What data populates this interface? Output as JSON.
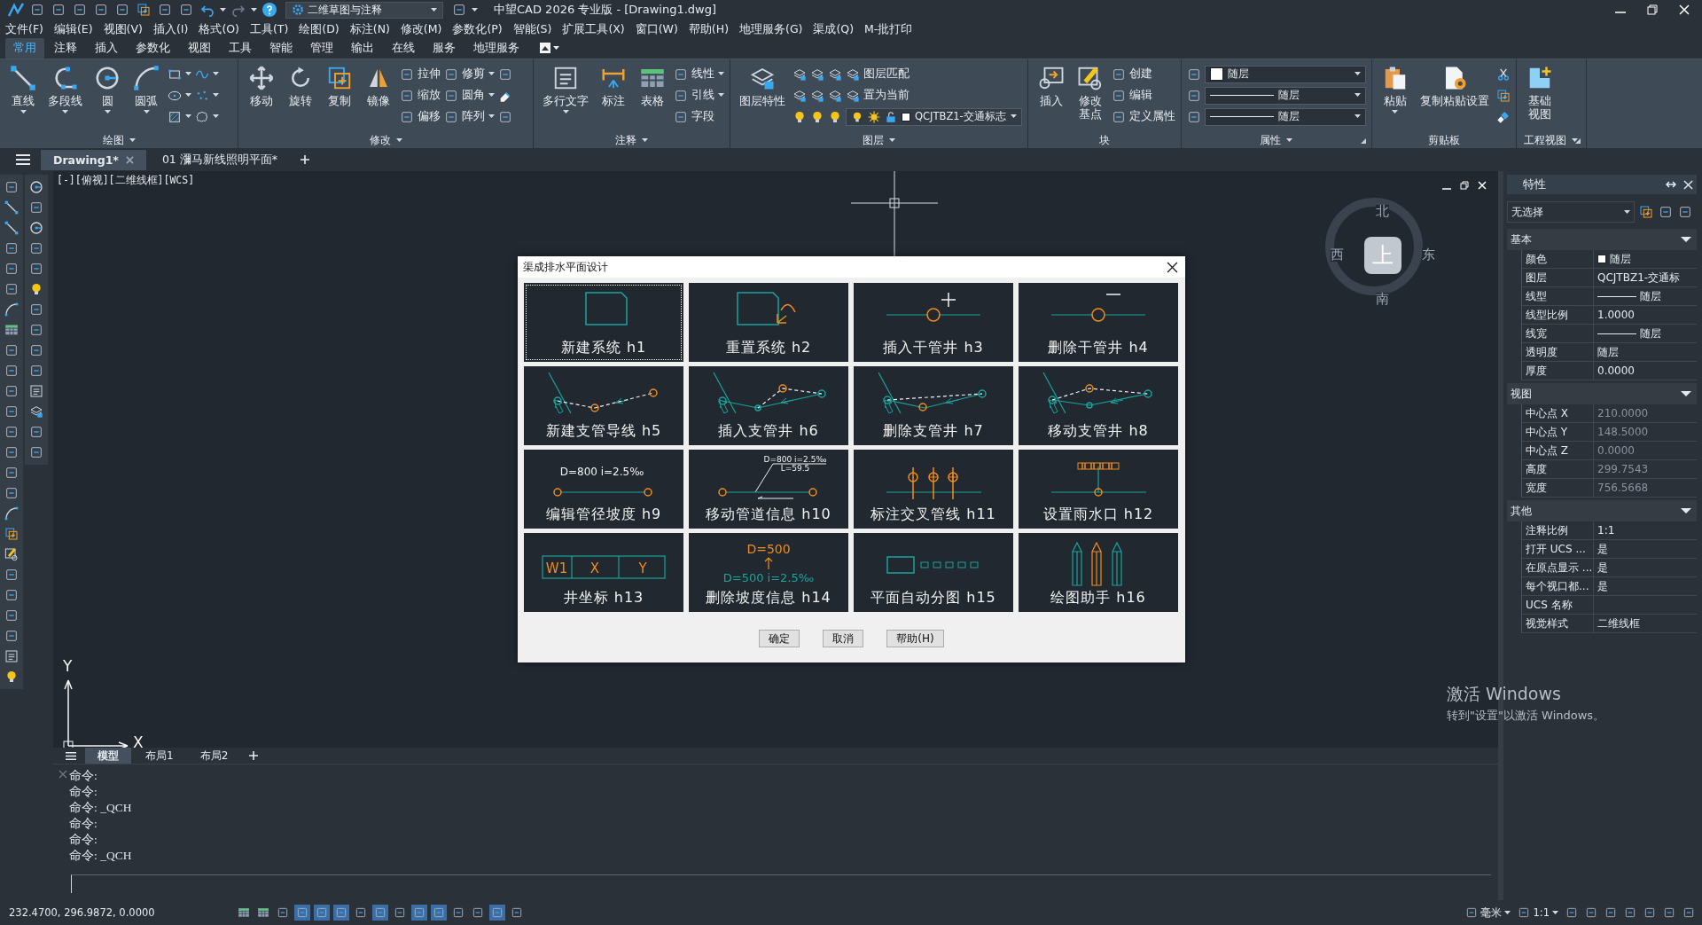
{
  "title_bar": {
    "workspace": "二维草图与注释",
    "title": "中望CAD 2026 专业版 - [Drawing1.dwg]"
  },
  "menu_bar": [
    "文件(F)",
    "编辑(E)",
    "视图(V)",
    "插入(I)",
    "格式(O)",
    "工具(T)",
    "绘图(D)",
    "标注(N)",
    "修改(M)",
    "参数化(P)",
    "智能(S)",
    "扩展工具(X)",
    "窗口(W)",
    "帮助(H)",
    "地理服务(G)",
    "渠成(Q)",
    "M-批打印"
  ],
  "ribbon_tabs": [
    {
      "label": "常用",
      "selected": true
    },
    {
      "label": "注释",
      "selected": false
    },
    {
      "label": "插入",
      "selected": false
    },
    {
      "label": "参数化",
      "selected": false
    },
    {
      "label": "视图",
      "selected": false
    },
    {
      "label": "工具",
      "selected": false
    },
    {
      "label": "智能",
      "selected": false
    },
    {
      "label": "管理",
      "selected": false
    },
    {
      "label": "输出",
      "selected": false
    },
    {
      "label": "在线",
      "selected": false
    },
    {
      "label": "服务",
      "selected": false
    },
    {
      "label": "地理服务",
      "selected": false
    }
  ],
  "ribbon_panels": [
    {
      "title": "绘图",
      "dropdown": true,
      "launcher": false,
      "tools": [
        {
          "kind": "large",
          "label": "直线",
          "dropdown": true
        },
        {
          "kind": "large",
          "label": "多段线",
          "dropdown": true
        },
        {
          "kind": "large",
          "label": "圆",
          "dropdown": true
        },
        {
          "kind": "large",
          "label": "圆弧",
          "dropdown": true
        },
        {
          "kind": "icon",
          "dropdown": true
        },
        {
          "kind": "icon",
          "dropdown": true
        },
        {
          "kind": "icon",
          "dropdown": true
        },
        {
          "kind": "icon",
          "dropdown": true
        },
        {
          "kind": "icon",
          "dropdown": true
        },
        {
          "kind": "icon",
          "dropdown": true
        }
      ]
    },
    {
      "title": "修改",
      "dropdown": true,
      "launcher": false,
      "tools": [
        {
          "kind": "large",
          "label": "移动",
          "dropdown": false
        },
        {
          "kind": "large",
          "label": "旋转",
          "dropdown": false
        },
        {
          "kind": "large",
          "label": "复制",
          "dropdown": false
        },
        {
          "kind": "large",
          "label": "镜像",
          "dropdown": false
        },
        {
          "kind": "small",
          "label": "拉伸",
          "dropdown": false
        },
        {
          "kind": "small",
          "label": "缩放",
          "dropdown": false
        },
        {
          "kind": "small",
          "label": "偏移",
          "dropdown": false
        },
        {
          "kind": "small",
          "label": "修剪",
          "dropdown": true
        },
        {
          "kind": "small",
          "label": "圆角",
          "dropdown": true
        },
        {
          "kind": "small",
          "label": "阵列",
          "dropdown": true
        },
        {
          "kind": "icon",
          "dropdown": false
        },
        {
          "kind": "icon",
          "dropdown": false
        },
        {
          "kind": "icon",
          "dropdown": false
        }
      ]
    },
    {
      "title": "注释",
      "dropdown": true,
      "launcher": false,
      "tools": [
        {
          "kind": "large",
          "label": "多行文字",
          "dropdown": true
        },
        {
          "kind": "large",
          "label": "标注",
          "dropdown": false
        },
        {
          "kind": "large",
          "label": "表格",
          "dropdown": false
        },
        {
          "kind": "small",
          "label": "线性",
          "dropdown": true
        },
        {
          "kind": "small",
          "label": "引线",
          "dropdown": true
        },
        {
          "kind": "small",
          "label": "字段",
          "dropdown": false
        }
      ]
    },
    {
      "title": "图层",
      "dropdown": true,
      "launcher": false,
      "tools": [
        {
          "kind": "large",
          "label": "图层特性",
          "dropdown": false
        },
        {
          "kind": "icon",
          "dropdown": false
        },
        {
          "kind": "icon",
          "dropdown": false
        },
        {
          "kind": "icon",
          "dropdown": false
        },
        {
          "kind": "icon",
          "dropdown": false
        },
        {
          "kind": "icon",
          "dropdown": false
        },
        {
          "kind": "icon",
          "dropdown": false
        },
        {
          "kind": "icon",
          "dropdown": false
        },
        {
          "kind": "icon",
          "dropdown": false
        },
        {
          "kind": "icon",
          "dropdown": false
        },
        {
          "kind": "small",
          "label": "图层匹配",
          "dropdown": false
        },
        {
          "kind": "small",
          "label": "置为当前",
          "dropdown": false
        },
        {
          "kind": "layercombo",
          "label": "QCJTBZ1-交通标志"
        }
      ]
    },
    {
      "title": "块",
      "dropdown": false,
      "launcher": false,
      "tools": [
        {
          "kind": "large",
          "label": "插入",
          "dropdown": false
        },
        {
          "kind": "large",
          "label": "修改基点",
          "dropdown": false
        },
        {
          "kind": "small",
          "label": "创建",
          "dropdown": false
        },
        {
          "kind": "small",
          "label": "编辑",
          "dropdown": false
        },
        {
          "kind": "small",
          "label": "定义属性",
          "dropdown": false
        }
      ]
    },
    {
      "title": "属性",
      "dropdown": true,
      "launcher": true,
      "tools": [
        {
          "kind": "colorcombo",
          "label": "随层"
        },
        {
          "kind": "linecombo",
          "label": "随层"
        },
        {
          "kind": "linecombo",
          "label": "随层"
        }
      ]
    },
    {
      "title": "剪贴板",
      "dropdown": false,
      "launcher": false,
      "tools": [
        {
          "kind": "large",
          "label": "粘贴",
          "dropdown": true
        },
        {
          "kind": "large",
          "label": "复制粘贴设置",
          "dropdown": false
        },
        {
          "kind": "icon",
          "dropdown": false
        },
        {
          "kind": "icon",
          "dropdown": false
        },
        {
          "kind": "icon",
          "dropdown": false
        }
      ]
    },
    {
      "title": "工程视图",
      "dropdown": true,
      "launcher": true,
      "tools": [
        {
          "kind": "large",
          "label": "基础视图",
          "dropdown": false
        }
      ]
    }
  ],
  "doc_tabs": [
    {
      "label": "Drawing1*",
      "selected": true
    },
    {
      "label": "01 瀰马新线照明平面*",
      "selected": false
    }
  ],
  "viewport_label": "[-][俯视][二维线框][WCS]",
  "compass": {
    "north": "北",
    "west": "西",
    "center": "上",
    "east": "东",
    "south": "南"
  },
  "ucs": {
    "y": "Y",
    "x": "X"
  },
  "dialog": {
    "title": "渠成排水平面设计",
    "tiles": [
      {
        "label": "新建系统 h1",
        "selected": true
      },
      {
        "label": "重置系统 h2",
        "selected": false
      },
      {
        "label": "插入干管井 h3",
        "selected": false
      },
      {
        "label": "删除干管井 h4",
        "selected": false
      },
      {
        "label": "新建支管导线 h5",
        "selected": false
      },
      {
        "label": "插入支管井 h6",
        "selected": false
      },
      {
        "label": "删除支管井 h7",
        "selected": false
      },
      {
        "label": "移动支管井 h8",
        "selected": false
      },
      {
        "label": "编辑管径坡度 h9",
        "selected": false,
        "figure_text": [
          "D=800 i=2.5‰"
        ]
      },
      {
        "label": "移动管道信息 h10",
        "selected": false,
        "figure_text": [
          "D=800 i=2.5‰",
          "L=59.5"
        ]
      },
      {
        "label": "标注交叉管线 h11",
        "selected": false
      },
      {
        "label": "设置雨水口 h12",
        "selected": false
      },
      {
        "label": "井坐标 h13",
        "selected": false,
        "figure_text": [
          "W1",
          "X",
          "Y"
        ]
      },
      {
        "label": "删除坡度信息 h14",
        "selected": false,
        "figure_text": [
          "D=500",
          "D=500 i=2.5‰"
        ]
      },
      {
        "label": "平面自动分图 h15",
        "selected": false
      },
      {
        "label": "绘图助手 h16",
        "selected": false
      }
    ],
    "buttons": [
      "确定",
      "取消",
      "帮助(H)"
    ]
  },
  "layout_tabs": [
    {
      "label": "模型",
      "selected": true
    },
    {
      "label": "布局1",
      "selected": false
    },
    {
      "label": "布局2",
      "selected": false
    }
  ],
  "command_lines": [
    "命令:",
    "命令:",
    "命令: _QCH",
    "命令:",
    "命令:",
    "命令: _QCH"
  ],
  "properties": {
    "title": "特性",
    "selection": "无选择",
    "sections": [
      {
        "title": "基本",
        "rows": [
          {
            "kind": "swatch",
            "name": "颜色",
            "value": "随层",
            "disabled": false
          },
          {
            "kind": "text",
            "name": "图层",
            "value": "QCJTBZ1-交通标",
            "disabled": false
          },
          {
            "kind": "line",
            "name": "线型",
            "value": "随层",
            "disabled": false
          },
          {
            "kind": "text",
            "name": "线型比例",
            "value": "1.0000",
            "disabled": false
          },
          {
            "kind": "line",
            "name": "线宽",
            "value": "随层",
            "disabled": false
          },
          {
            "kind": "text",
            "name": "透明度",
            "value": "随层",
            "disabled": false
          },
          {
            "kind": "text",
            "name": "厚度",
            "value": "0.0000",
            "disabled": false
          }
        ]
      },
      {
        "title": "视图",
        "rows": [
          {
            "kind": "text",
            "name": "中心点 X",
            "value": "210.0000",
            "disabled": true
          },
          {
            "kind": "text",
            "name": "中心点 Y",
            "value": "148.5000",
            "disabled": true
          },
          {
            "kind": "text",
            "name": "中心点 Z",
            "value": "0.0000",
            "disabled": true
          },
          {
            "kind": "text",
            "name": "高度",
            "value": "299.7543",
            "disabled": true
          },
          {
            "kind": "text",
            "name": "宽度",
            "value": "756.5668",
            "disabled": true
          }
        ]
      },
      {
        "title": "其他",
        "rows": [
          {
            "kind": "text",
            "name": "注释比例",
            "value": "1:1",
            "disabled": false
          },
          {
            "kind": "text",
            "name": "打开 UCS ...",
            "value": "是",
            "disabled": false
          },
          {
            "kind": "text",
            "name": "在原点显示 ...",
            "value": "是",
            "disabled": false
          },
          {
            "kind": "text",
            "name": "每个视口都...",
            "value": "是",
            "disabled": false
          },
          {
            "kind": "text",
            "name": "UCS 名称"
          },
          {
            "kind": "text",
            "name": "视觉样式",
            "value": "二维线框",
            "disabled": false
          }
        ]
      }
    ]
  },
  "watermark_notice": {
    "title": "激活 Windows",
    "text": "转到\"设置\"以激活 Windows。"
  },
  "status_bar": {
    "coordinates": "232.4700, 296.9872, 0.0000",
    "unit": "毫米",
    "scale": "1:1"
  }
}
